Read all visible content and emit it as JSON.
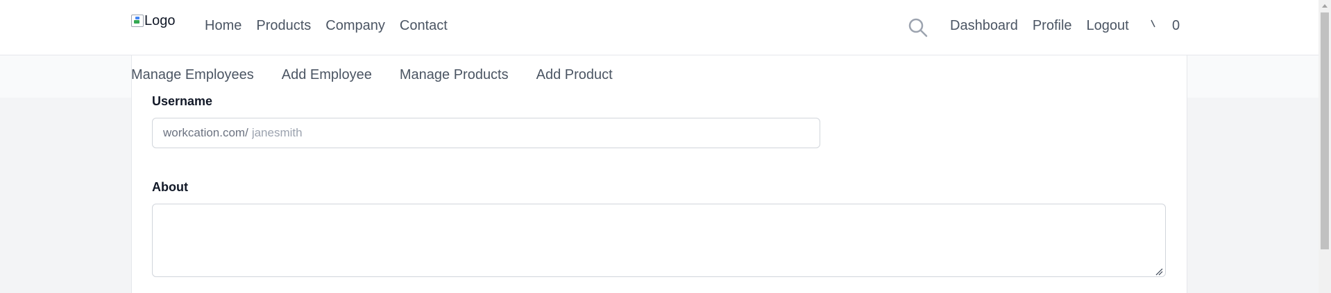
{
  "header": {
    "logo_alt": "Logo",
    "nav": [
      "Home",
      "Products",
      "Company",
      "Contact"
    ],
    "right_nav": [
      "Dashboard",
      "Profile",
      "Logout"
    ],
    "cart_count": "0"
  },
  "subnav": [
    "Manage Employees",
    "Add Employee",
    "Manage Products",
    "Add Product"
  ],
  "form": {
    "username_label": "Username",
    "username_prefix": "workcation.com/",
    "username_placeholder": "janesmith",
    "about_label": "About",
    "about_value": ""
  }
}
